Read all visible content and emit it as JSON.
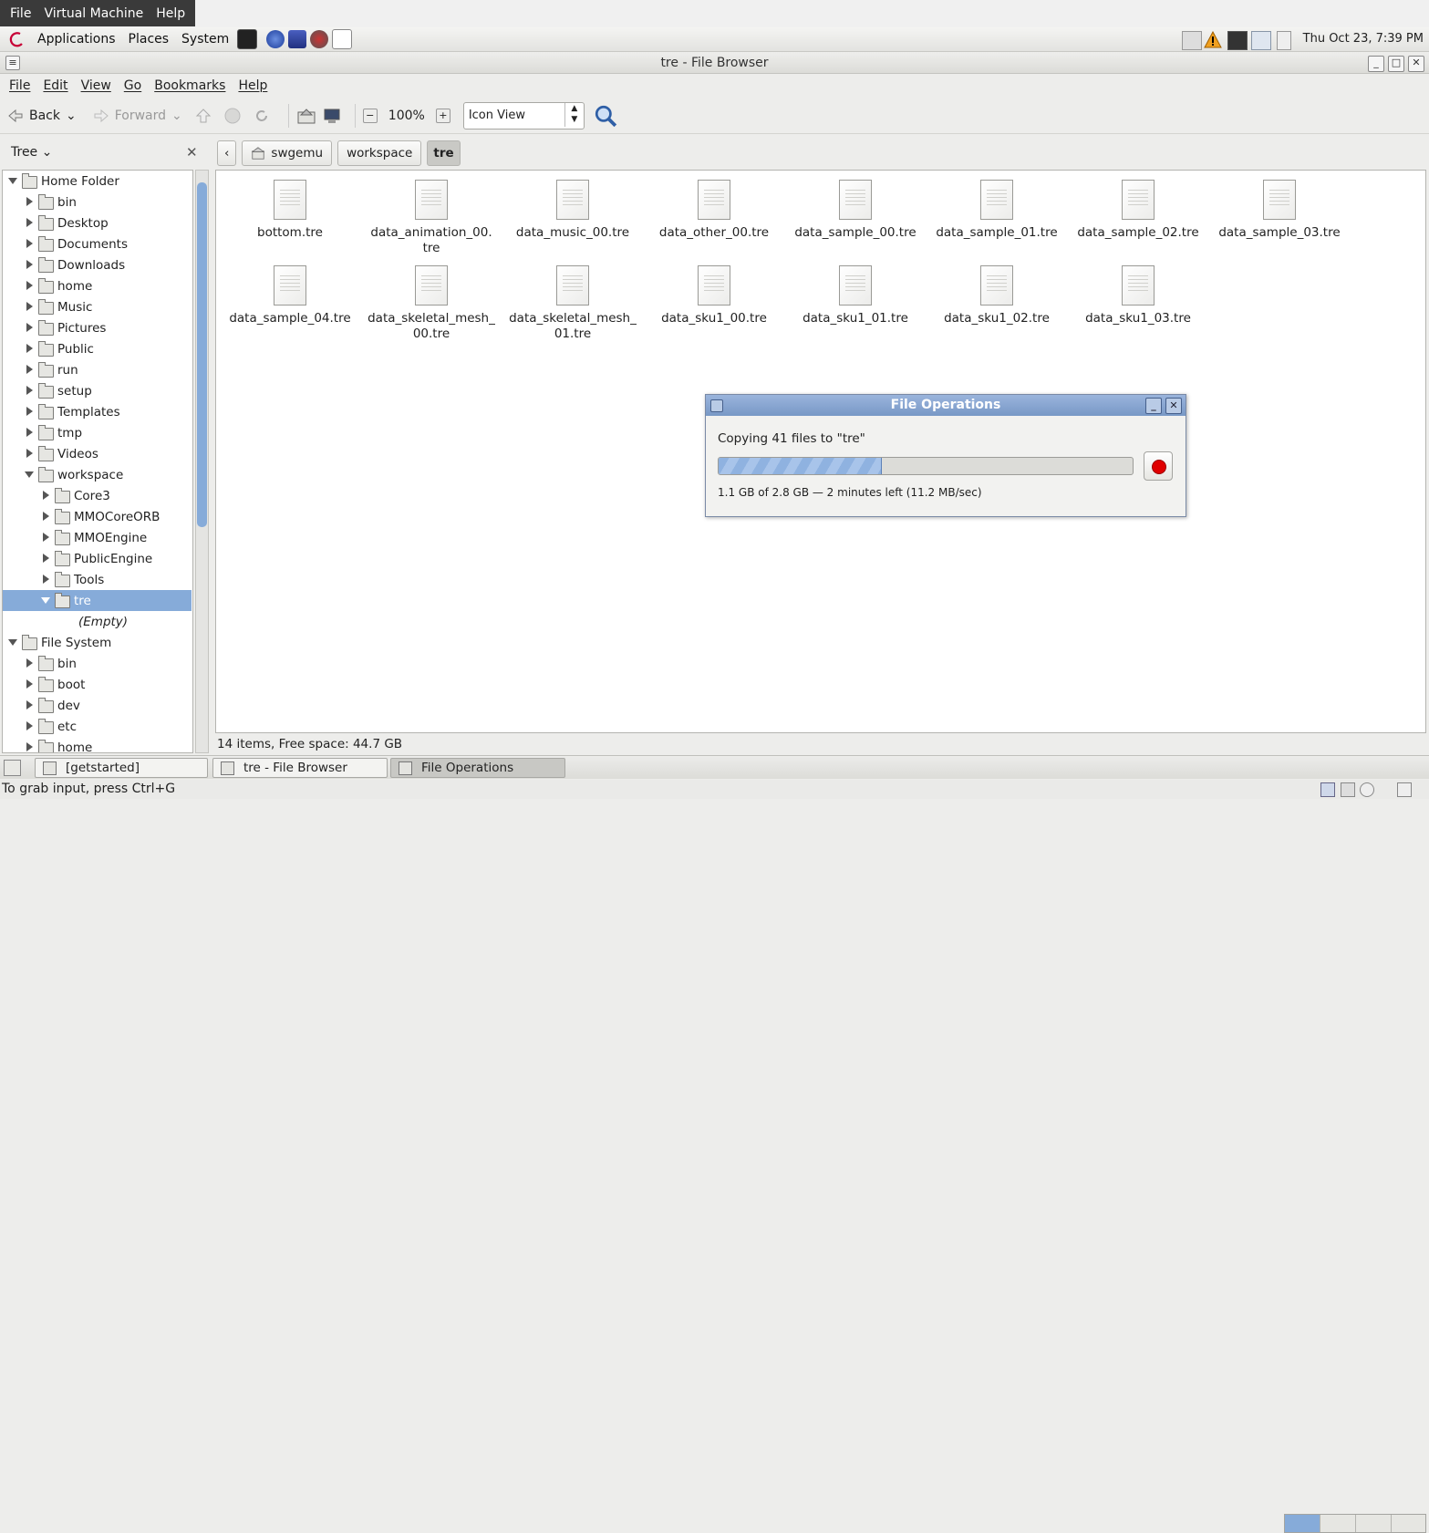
{
  "vm_menubar": {
    "items": [
      "File",
      "Virtual Machine",
      "Help"
    ]
  },
  "top_panel": {
    "menus": [
      "Applications",
      "Places",
      "System"
    ],
    "clock": "Thu Oct 23,  7:39 PM"
  },
  "window": {
    "title": "tre - File Browser"
  },
  "app_menubar": {
    "items": [
      "File",
      "Edit",
      "View",
      "Go",
      "Bookmarks",
      "Help"
    ]
  },
  "toolbar": {
    "back_label": "Back",
    "forward_label": "Forward",
    "zoom_level": "100%",
    "view_mode": "Icon View"
  },
  "sidebar": {
    "mode": "Tree",
    "items": [
      {
        "label": "Home Folder",
        "depth": 0,
        "expanded": true
      },
      {
        "label": "bin",
        "depth": 1
      },
      {
        "label": "Desktop",
        "depth": 1
      },
      {
        "label": "Documents",
        "depth": 1
      },
      {
        "label": "Downloads",
        "depth": 1
      },
      {
        "label": "home",
        "depth": 1
      },
      {
        "label": "Music",
        "depth": 1
      },
      {
        "label": "Pictures",
        "depth": 1
      },
      {
        "label": "Public",
        "depth": 1
      },
      {
        "label": "run",
        "depth": 1
      },
      {
        "label": "setup",
        "depth": 1
      },
      {
        "label": "Templates",
        "depth": 1
      },
      {
        "label": "tmp",
        "depth": 1
      },
      {
        "label": "Videos",
        "depth": 1
      },
      {
        "label": "workspace",
        "depth": 1,
        "expanded": true
      },
      {
        "label": "Core3",
        "depth": 2
      },
      {
        "label": "MMOCoreORB",
        "depth": 2
      },
      {
        "label": "MMOEngine",
        "depth": 2
      },
      {
        "label": "PublicEngine",
        "depth": 2
      },
      {
        "label": "Tools",
        "depth": 2
      },
      {
        "label": "tre",
        "depth": 2,
        "expanded": true,
        "selected": true
      },
      {
        "label": "(Empty)",
        "depth": 3,
        "placeholder": true
      },
      {
        "label": "File System",
        "depth": 0,
        "expanded": true
      },
      {
        "label": "bin",
        "depth": 1
      },
      {
        "label": "boot",
        "depth": 1
      },
      {
        "label": "dev",
        "depth": 1
      },
      {
        "label": "etc",
        "depth": 1
      },
      {
        "label": "home",
        "depth": 1
      }
    ]
  },
  "pathbar": {
    "segments": [
      "swgemu",
      "workspace",
      "tre"
    ]
  },
  "files": [
    "bottom.tre",
    "data_animation_00.\ntre",
    "data_music_00.tre",
    "data_other_00.tre",
    "data_sample_00.tre",
    "data_sample_01.tre",
    "data_sample_02.tre",
    "data_sample_03.tre",
    "data_sample_04.tre",
    "data_skeletal_mesh_\n00.tre",
    "data_skeletal_mesh_\n01.tre",
    "data_sku1_00.tre",
    "data_sku1_01.tre",
    "data_sku1_02.tre",
    "data_sku1_03.tre"
  ],
  "status_bar": {
    "text": "14 items, Free space: 44.7 GB"
  },
  "dialog": {
    "title": "File Operations",
    "message": "Copying 41 files to \"tre\"",
    "progress_fraction": 0.393,
    "detail": "1.1 GB of 2.8 GB — 2 minutes left (11.2 MB/sec)"
  },
  "taskbar": {
    "tasks": [
      "[getstarted]",
      "tre - File Browser",
      "File Operations"
    ]
  },
  "vm_status": {
    "text": "To grab input, press Ctrl+G"
  },
  "colors": {
    "selection": "#86abd9",
    "stop": "#e00000"
  }
}
